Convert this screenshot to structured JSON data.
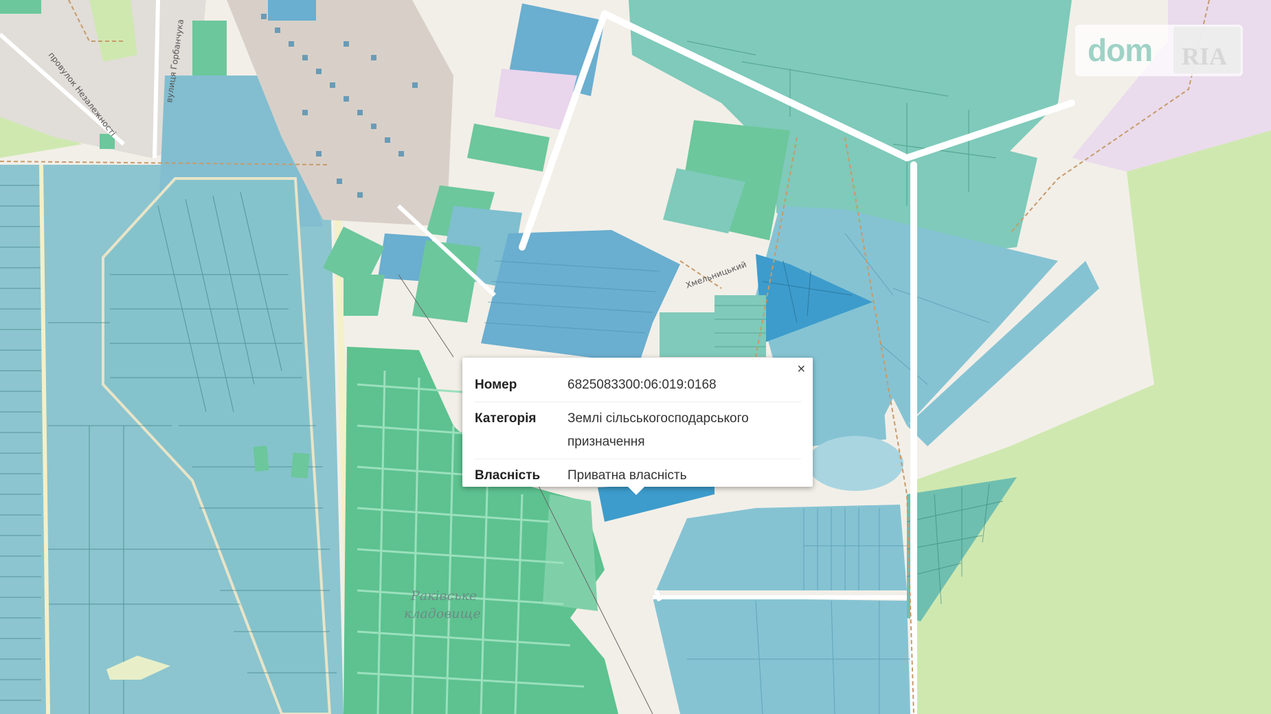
{
  "map": {
    "colors": {
      "background": "#f2efe8",
      "forest_green": "#cfe8b0",
      "pink_zone": "#eadcec",
      "parcel_blue": "#7fbfd0",
      "parcel_teal": "#7fcaba",
      "parcel_green": "#6cc79c",
      "selected_parcel": "#3d9ccc",
      "cemetery": "#5dc28f",
      "road": "#ffffff",
      "path_dashed": "#c79a6a"
    },
    "street_labels": {
      "provulok": "провулок Незалежності",
      "vulytsia": "вулиця Горбанчука",
      "khmelnytskyi": "Хмельницький"
    },
    "place_label": {
      "line1": "Ракiвське",
      "line2": "кладовище"
    }
  },
  "popup": {
    "close_icon": "×",
    "rows": [
      {
        "key": "Номер",
        "value": "6825083300:06:019:0168"
      },
      {
        "key": "Категорія",
        "value": "Землі сільськогосподарського призначення"
      },
      {
        "key": "Власність",
        "value": "Приватна власність"
      }
    ]
  },
  "watermark": {
    "dom": "dom",
    "ria": "RIA"
  }
}
